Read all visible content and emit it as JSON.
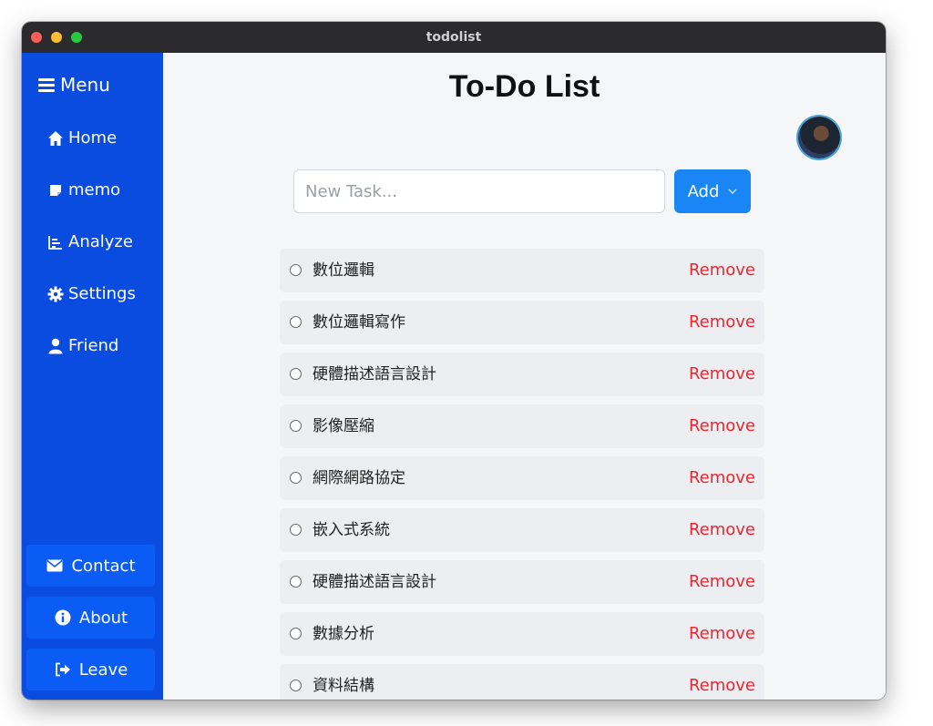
{
  "window": {
    "title": "todolist"
  },
  "sidebar": {
    "menu_label": "Menu",
    "items": [
      {
        "label": "Home",
        "icon": "home-icon"
      },
      {
        "label": "memo",
        "icon": "memo-icon"
      },
      {
        "label": "Analyze",
        "icon": "chart-icon"
      },
      {
        "label": "Settings",
        "icon": "gear-icon"
      },
      {
        "label": "Friend",
        "icon": "user-icon"
      }
    ],
    "buttons": [
      {
        "label": "Contact",
        "icon": "envelope-icon"
      },
      {
        "label": "About",
        "icon": "info-icon"
      },
      {
        "label": "Leave",
        "icon": "sign-out-icon"
      }
    ]
  },
  "main": {
    "title": "To-Do List",
    "input": {
      "placeholder": "New Task...",
      "value": ""
    },
    "add_label": "Add",
    "remove_label": "Remove",
    "tasks": [
      {
        "text": "數位邏輯"
      },
      {
        "text": "數位邏輯寫作"
      },
      {
        "text": "硬體描述語言設計"
      },
      {
        "text": "影像壓縮"
      },
      {
        "text": "網際網路協定"
      },
      {
        "text": "嵌入式系統"
      },
      {
        "text": "硬體描述語言設計"
      },
      {
        "text": "數據分析"
      },
      {
        "text": "資料結構"
      },
      {
        "text": ""
      }
    ]
  },
  "colors": {
    "sidebar": "#0a4be0",
    "sidebar_button": "#0b5cf5",
    "accent": "#1a86f5",
    "danger": "#f0242f",
    "task_bg": "#eceef1",
    "titlebar": "#2b2b2d"
  }
}
